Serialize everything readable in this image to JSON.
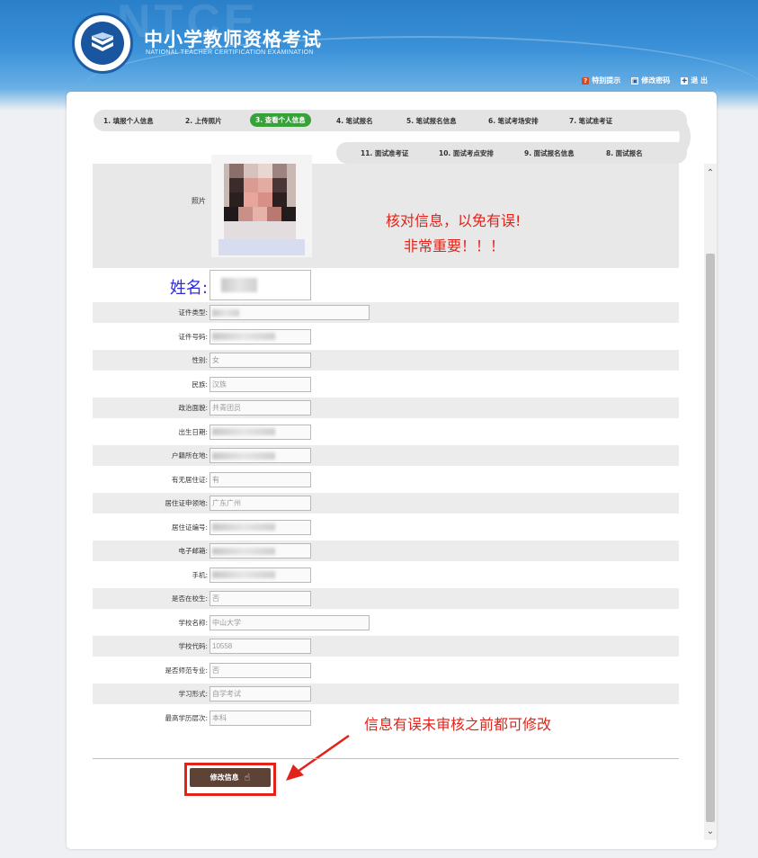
{
  "header": {
    "watermark": "NTCE",
    "title": "中小学教师资格考试",
    "subtitle": "NATIONAL TEACHER CERTIFICATION EXAMINATION",
    "links": [
      {
        "label": "特别提示",
        "icon": "alert-icon"
      },
      {
        "label": "修改密码",
        "icon": "key-icon"
      },
      {
        "label": "退 出",
        "icon": "exit-icon"
      }
    ]
  },
  "steps": {
    "row1": [
      "1. 填报个人信息",
      "2. 上传照片",
      "3. 查看个人信息",
      "4. 笔试报名",
      "5. 笔试报名信息",
      "6. 笔试考场安排",
      "7. 笔试准考证"
    ],
    "row2": [
      "11. 面试准考证",
      "10. 面试考点安排",
      "9. 面试报名信息",
      "8. 面试报名"
    ],
    "active_index": 2
  },
  "photo": {
    "label": "照片"
  },
  "name": {
    "label": "姓名:"
  },
  "fields": [
    {
      "label": "证件类型:",
      "value": "",
      "blurred": true,
      "wide": true
    },
    {
      "label": "证件号码:",
      "value": "",
      "blurred": true
    },
    {
      "label": "性别:",
      "value": "女"
    },
    {
      "label": "民族:",
      "value": "汉族"
    },
    {
      "label": "政治面貌:",
      "value": "共青团员"
    },
    {
      "label": "出生日期:",
      "value": "",
      "blurred": true
    },
    {
      "label": "户籍所在地:",
      "value": "",
      "blurred": true
    },
    {
      "label": "有无居住证:",
      "value": "有"
    },
    {
      "label": "居住证申领地:",
      "value": "广东广州"
    },
    {
      "label": "居住证编号:",
      "value": "",
      "blurred": true
    },
    {
      "label": "电子邮箱:",
      "value": "",
      "blurred": true
    },
    {
      "label": "手机:",
      "value": "",
      "blurred": true
    },
    {
      "label": "是否在校生:",
      "value": "否"
    },
    {
      "label": "学校名称:",
      "value": "中山大学",
      "wide": true
    },
    {
      "label": "学校代码:",
      "value": "10558"
    },
    {
      "label": "是否师范专业:",
      "value": "否"
    },
    {
      "label": "学习形式:",
      "value": "自学考试"
    },
    {
      "label": "最高学历层次:",
      "value": "本科"
    }
  ],
  "annotations": {
    "verify_line1": "核对信息，以免有误!",
    "verify_line2": "非常重要！！！",
    "edit_note": "信息有误未审核之前都可修改"
  },
  "button": {
    "edit_label": "修改信息"
  },
  "colors": {
    "accent_red": "#e2231a",
    "active_step": "#39a13a",
    "header_blue": "#2a7fc9",
    "button_brown": "#5d4336"
  }
}
